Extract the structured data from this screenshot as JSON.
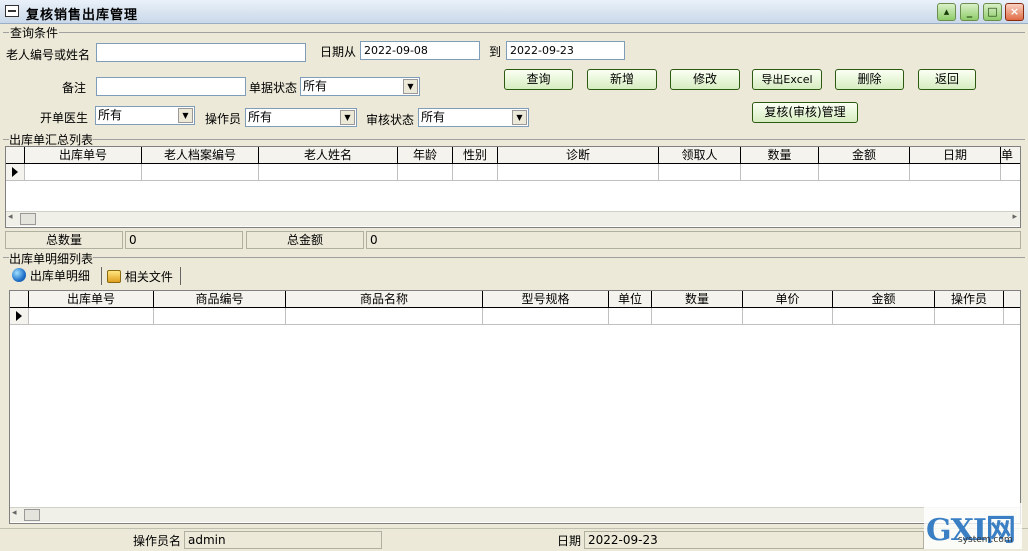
{
  "window": {
    "title": "复核销售出库管理"
  },
  "query": {
    "group_label": "查询条件",
    "elder_label": "老人编号或姓名",
    "elder_value": "",
    "date_from_label": "日期从",
    "date_from": "2022-09-08",
    "date_to_label": "到",
    "date_to": "2022-09-23",
    "remark_label": "备注",
    "remark_value": "",
    "doc_status_label": "单据状态",
    "doc_status": "所有",
    "doctor_label": "开单医生",
    "doctor": "所有",
    "operator_label": "操作员",
    "operator": "所有",
    "audit_label": "审核状态",
    "audit": "所有"
  },
  "buttons": {
    "search": "查询",
    "add": "新增",
    "edit": "修改",
    "export": "导出Excel",
    "delete": "删除",
    "back": "返回",
    "audit_manage": "复核(审核)管理"
  },
  "summary_grid": {
    "group_label": "出库单汇总列表",
    "columns": [
      "出库单号",
      "老人档案编号",
      "老人姓名",
      "年龄",
      "性别",
      "诊断",
      "领取人",
      "数量",
      "金额",
      "日期",
      "单"
    ]
  },
  "totals": {
    "qty_label": "总数量",
    "qty_value": "0",
    "amount_label": "总金额",
    "amount_value": "0"
  },
  "detail": {
    "group_label": "出库单明细列表",
    "tabs": [
      "出库单明细",
      "相关文件"
    ],
    "columns": [
      "出库单号",
      "商品编号",
      "商品名称",
      "型号规格",
      "单位",
      "数量",
      "单价",
      "金额",
      "操作员"
    ]
  },
  "status": {
    "operator_label": "操作员名",
    "operator_value": "admin",
    "date_label": "日期",
    "date_value": "2022-09-23"
  },
  "watermark": {
    "brand": "GXI网",
    "site": "system.com"
  }
}
